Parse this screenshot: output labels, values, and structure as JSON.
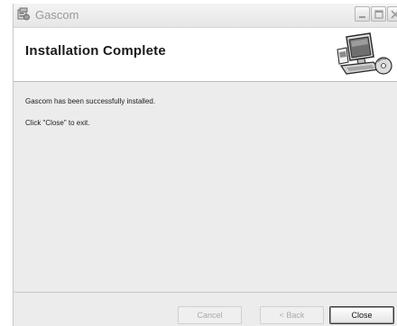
{
  "window": {
    "title": "Gascom",
    "app_icon": "installer-icon",
    "controls": [
      "minimize-icon",
      "maximize-icon",
      "close-icon"
    ]
  },
  "banner": {
    "title": "Installation Complete",
    "graphic": "computer-setup-icon"
  },
  "content": {
    "line1": "Gascom has been successfully installed.",
    "line2": "Click \"Close\" to exit."
  },
  "footer": {
    "cancel_label": "Cancel",
    "back_label": "< Back",
    "close_label": "Close",
    "cancel_enabled": false,
    "back_enabled": false,
    "close_enabled": true
  }
}
